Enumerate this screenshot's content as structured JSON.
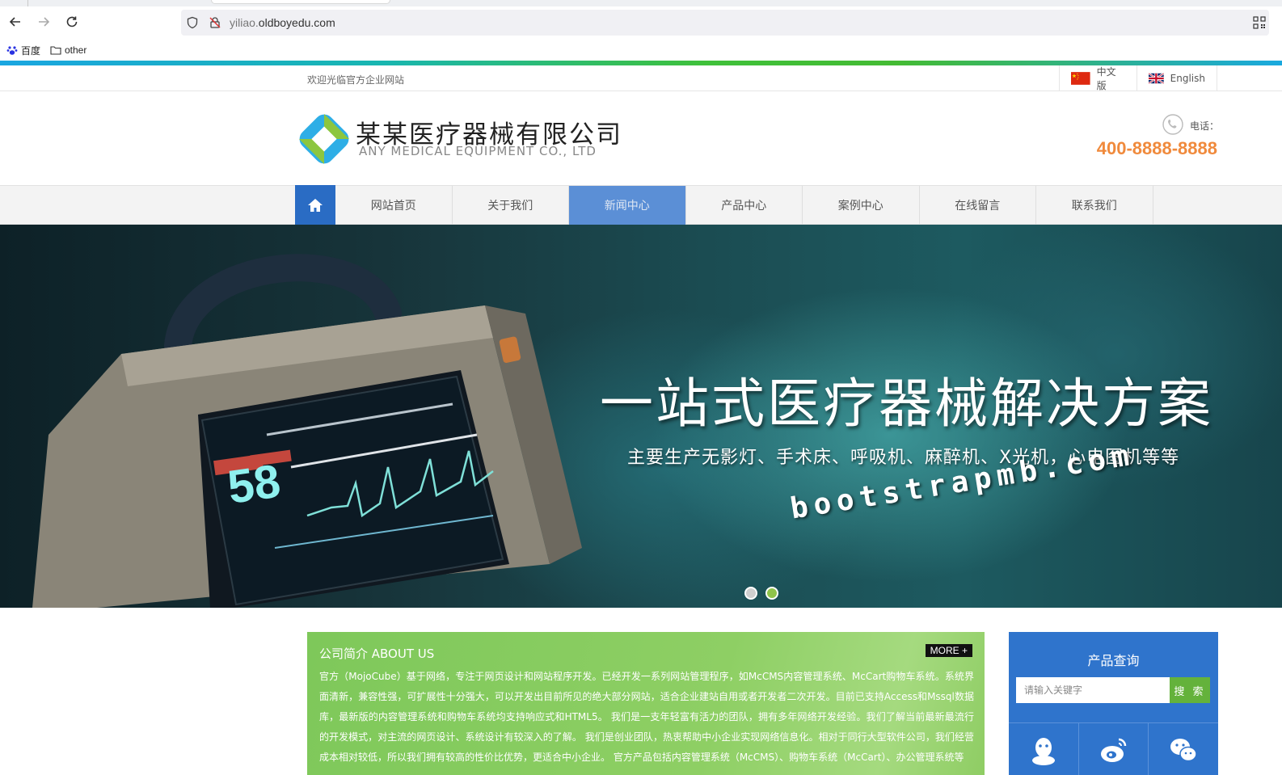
{
  "browser": {
    "url_host_prefix": "yiliao.",
    "url_host_main": "oldboyedu.com",
    "bookmarks": [
      {
        "label": "百度",
        "icon": "baidu-paw-icon"
      },
      {
        "label": "other",
        "icon": "folder-icon"
      }
    ]
  },
  "topbar": {
    "welcome": "欢迎光临官方企业网站",
    "lang_cn": "中文版",
    "lang_en": "English"
  },
  "header": {
    "logo_cn": "某某医疗器械有限公司",
    "logo_en": "ANY MEDICAL EQUIPMENT CO., LTD",
    "phone_label": "电话：",
    "phone_number": "400-8888-8888"
  },
  "nav": {
    "items": [
      "网站首页",
      "关于我们",
      "新闻中心",
      "产品中心",
      "案例中心",
      "在线留言",
      "联系我们"
    ],
    "active_index": 2
  },
  "banner": {
    "title": "一站式医疗器械解决方案",
    "subtitle": "主要生产无影灯、手术床、呼吸机、麻醉机、X光机，心电图机等等",
    "watermark": "bootstrapmb.com",
    "monitor_reading": "58",
    "slide_count": 2,
    "active_slide": 2
  },
  "about": {
    "title": "公司简介 ABOUT US",
    "more": "MORE +",
    "text": "官方（MojoCube）基于网络，专注于网页设计和网站程序开发。已经开发一系列网站管理程序，如McCMS内容管理系统、McCart购物车系统。系统界面清新，兼容性强，可扩展性十分强大，可以开发出目前所见的绝大部分网站，适合企业建站自用或者开发者二次开发。目前已支持Access和Mssql数据库，最新版的内容管理系统和购物车系统均支持响应式和HTML5。 我们是一支年轻富有活力的团队，拥有多年网络开发经验。我们了解当前最新最流行的开发模式，对主流的网页设计、系统设计有较深入的了解。 我们是创业团队，热衷帮助中小企业实现网络信息化。相对于同行大型软件公司，我们经营成本相对较低，所以我们拥有较高的性价比优势，更适合中小企业。 官方产品包括内容管理系统（McCMS）、购物车系统（McCart）、办公管理系统等"
  },
  "product_search": {
    "title": "产品查询",
    "placeholder": "请输入关键字",
    "button": "搜 索",
    "socials": [
      "qq-icon",
      "weibo-icon",
      "wechat-icon"
    ]
  },
  "colors": {
    "nav_active": "#5b8fd6",
    "nav_home": "#2a6cc4",
    "phone": "#f08a3c",
    "about_bg": "#8ecf64",
    "search_button": "#64b23b",
    "product_panel": "#2f74cc"
  }
}
